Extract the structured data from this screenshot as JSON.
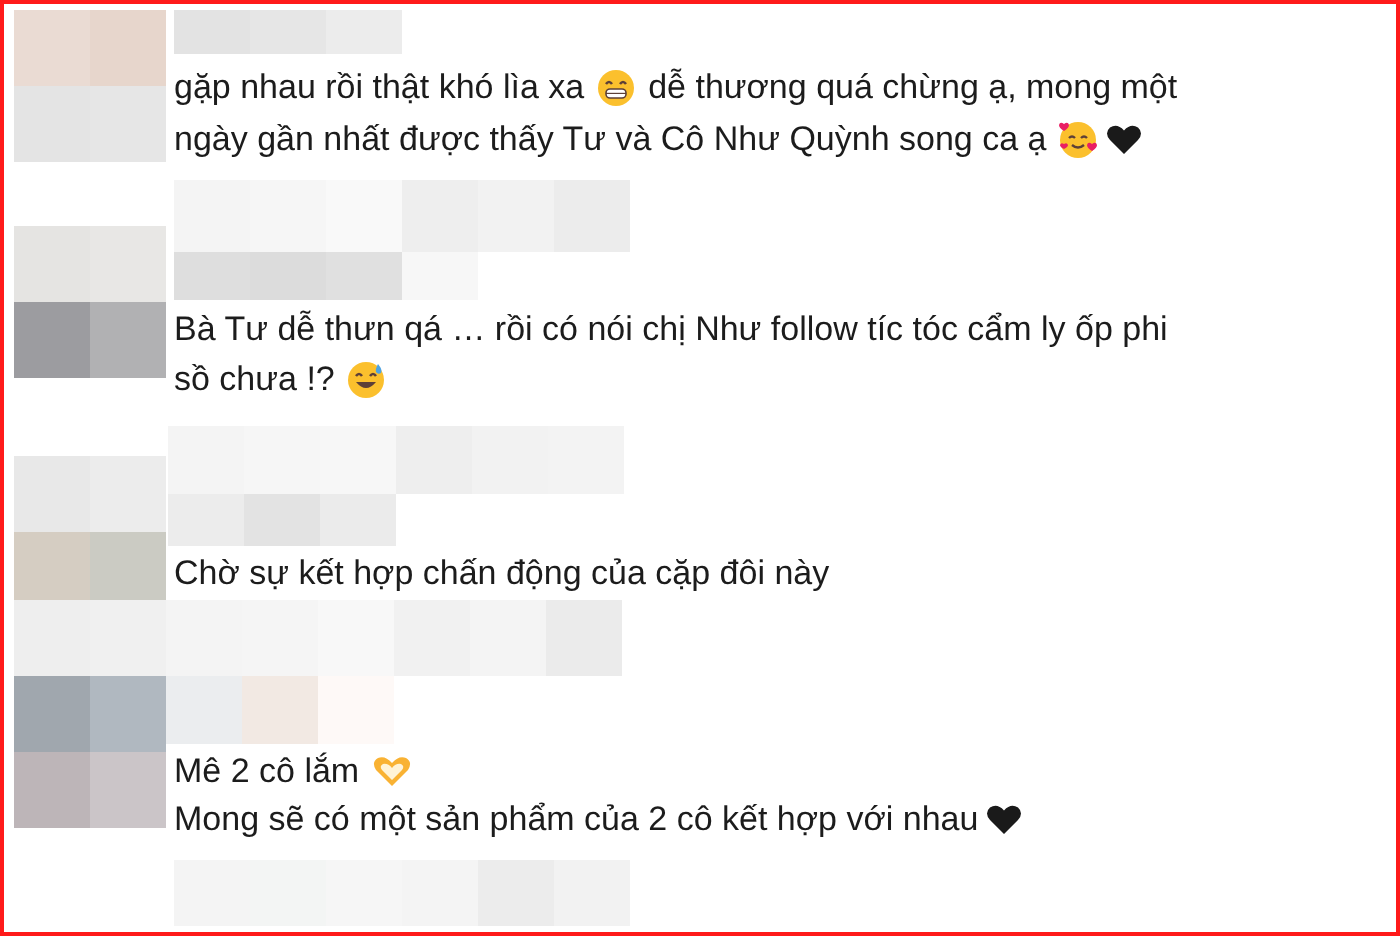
{
  "comments": [
    {
      "lines": [
        [
          {
            "kind": "text",
            "text": "gặp nhau rồi thật khó lìa xa"
          },
          {
            "kind": "grin"
          },
          {
            "kind": "text",
            "text": "dễ thương quá chừng ạ, mong một"
          }
        ],
        [
          {
            "kind": "text",
            "text": "ngày gần nhất được thấy Tư và Cô Như Quỳnh song ca ạ"
          },
          {
            "kind": "hearts-face"
          },
          {
            "kind": "black-heart"
          }
        ]
      ]
    },
    {
      "lines": [
        [
          {
            "kind": "text",
            "text": "Bà Tư dễ thưn qá … rồi có nói chị Như follow tíc tóc cẩm ly ốp phi"
          }
        ],
        [
          {
            "kind": "text",
            "text": "sồ chưa !?"
          },
          {
            "kind": "sweat-smile"
          }
        ]
      ]
    },
    {
      "lines": [
        [
          {
            "kind": "text",
            "text": "Chờ sự kết hợp chấn động của cặp đôi này"
          }
        ]
      ]
    },
    {
      "lines": [
        [
          {
            "kind": "text",
            "text": "Mê 2 cô lắm"
          },
          {
            "kind": "heart-hands"
          }
        ],
        [
          {
            "kind": "text",
            "text": "Mong sẽ có một sản phẩm của 2 cô kết hợp với nhau"
          },
          {
            "kind": "black-heart"
          }
        ]
      ]
    }
  ]
}
